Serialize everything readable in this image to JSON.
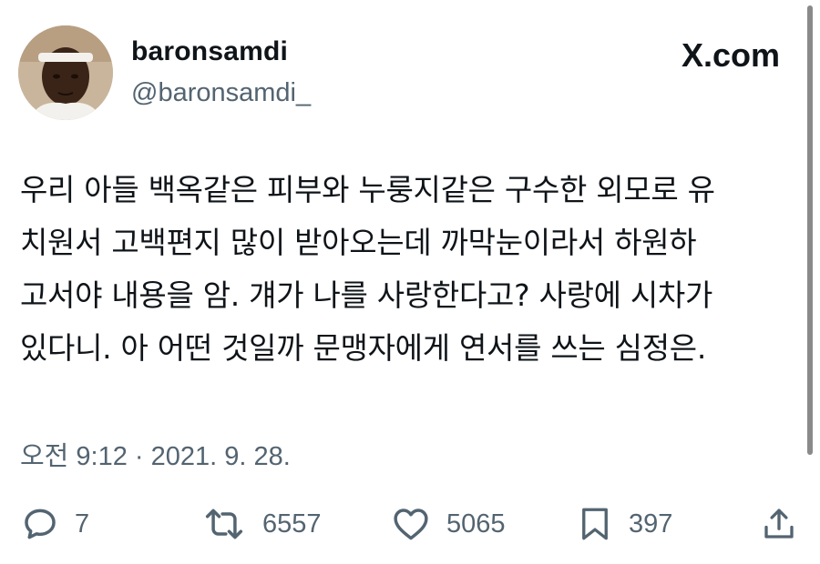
{
  "tweet": {
    "display_name": "baronsamdi",
    "handle": "@baronsamdi_",
    "brand": "X.com",
    "text": "우리 아들 백옥같은 피부와 누룽지같은 구수한 외모로 유\n치원서 고백편지 많이 받아오는데 까막눈이라서 하원하\n고서야 내용을 암. 걔가 나를 사랑한다고? 사랑에 시차가\n있다니. 아 어떤 것일까 문맹자에게 연서를 쓰는 심정은.",
    "timestamp": "오전 9:12 · 2021. 9. 28."
  },
  "actions": {
    "reply": {
      "icon": "reply-icon",
      "count": "7"
    },
    "retweet": {
      "icon": "retweet-icon",
      "count": "6557"
    },
    "like": {
      "icon": "heart-icon",
      "count": "5065"
    },
    "bookmark": {
      "icon": "bookmark-icon",
      "count": "397"
    },
    "share": {
      "icon": "share-icon"
    }
  },
  "colors": {
    "text_primary": "#0f1419",
    "text_secondary": "#536471",
    "background": "#ffffff"
  }
}
